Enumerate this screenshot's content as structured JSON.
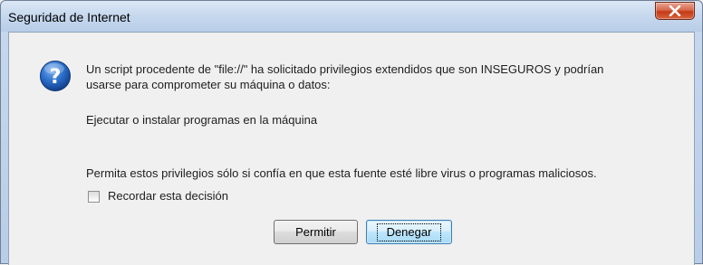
{
  "window": {
    "title": "Seguridad de Internet"
  },
  "message": {
    "line1": "Un script procedente de \"file://\" ha solicitado privilegios extendidos que son INSEGUROS y podrían",
    "line2": "usarse para comprometer su máquina o datos:",
    "privilege": "Ejecutar o instalar programas en la máquina",
    "warning": "Permita estos privilegios sólo si confía en que esta fuente esté libre virus o programas maliciosos."
  },
  "remember": {
    "label": "Recordar esta decisión",
    "checked": false
  },
  "buttons": {
    "allow": "Permitir",
    "deny": "Denegar"
  },
  "icons": {
    "dialog": "question-icon",
    "close": "close-icon"
  },
  "colors": {
    "close_button": "#c43a16",
    "question_icon": "#1f5fb8",
    "default_button_border": "#3c7fb1"
  }
}
